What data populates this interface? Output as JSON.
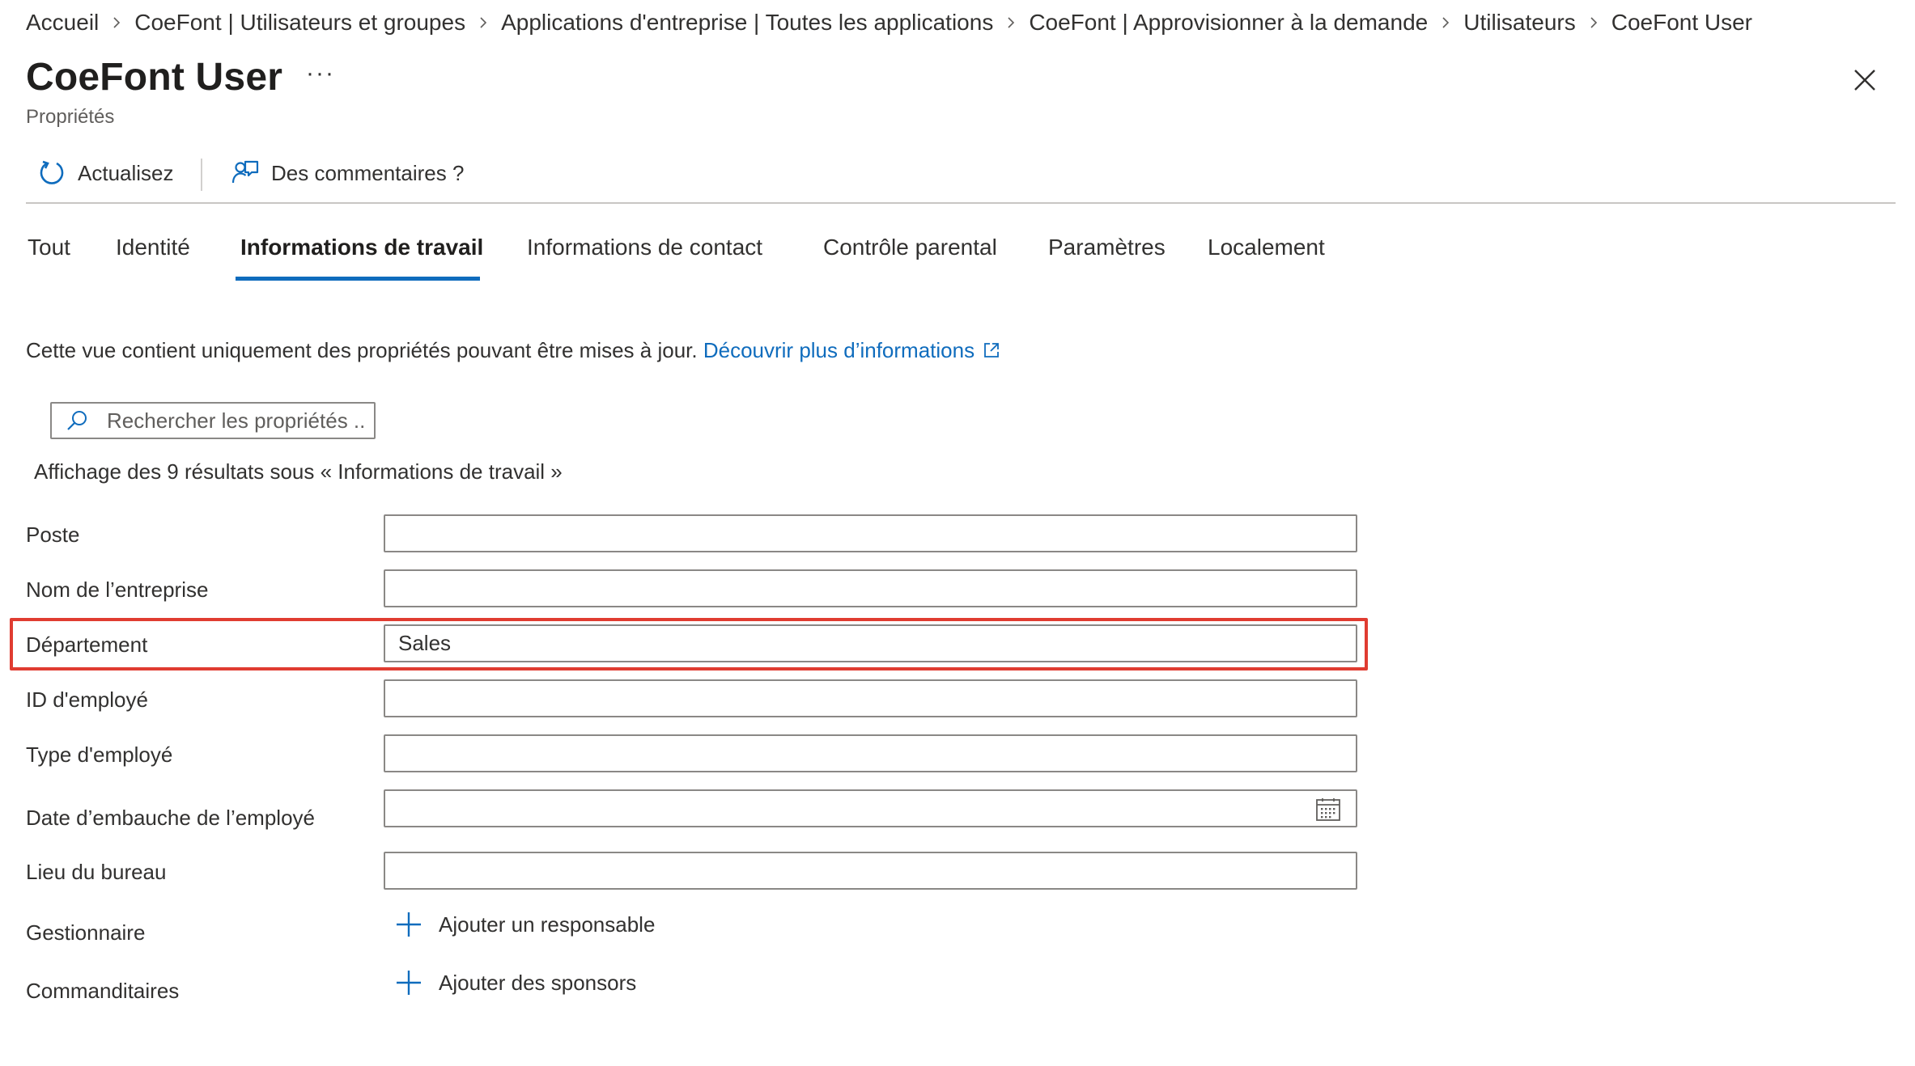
{
  "breadcrumb": [
    "Accueil",
    "CoeFont | Utilisateurs et groupes",
    "Applications d'entreprise | Toutes les applications",
    "CoeFont | Approvisionner à la demande",
    "Utilisateurs",
    "CoeFont User"
  ],
  "header": {
    "title": "CoeFont User",
    "more_label": "···",
    "subtitle": "Propriétés"
  },
  "toolbar": {
    "refresh_label": "Actualisez",
    "feedback_label": "Des commentaires ?"
  },
  "tabs": [
    "Tout",
    "Identité",
    "Informations de travail",
    "Informations de contact",
    "Contrôle parental",
    "Paramètres",
    "Localement"
  ],
  "active_tab": "Informations de travail",
  "info": {
    "text": "Cette vue contient uniquement des propriétés pouvant être mises à jour.",
    "link": "Découvrir plus d’informations"
  },
  "search": {
    "placeholder": "Rechercher les propriétés ...",
    "value": ""
  },
  "results_text": "Affichage des 9 résultats sous « Informations de travail »",
  "fields": [
    {
      "label": "Poste",
      "value": ""
    },
    {
      "label": "Nom de l’entreprise",
      "value": ""
    },
    {
      "label": "Département",
      "value": "Sales"
    },
    {
      "label": "ID d'employé",
      "value": ""
    },
    {
      "label": "Type d'employé",
      "value": ""
    },
    {
      "label": "Date d’embauche de l’employé",
      "value": ""
    },
    {
      "label": "Lieu du bureau",
      "value": ""
    }
  ],
  "manager": {
    "label": "Gestionnaire",
    "action": "Ajouter un responsable"
  },
  "sponsors": {
    "label": "Commanditaires",
    "action": "Ajouter des sponsors"
  },
  "colors": {
    "accent": "#0f6cbd",
    "highlight": "#e03c31",
    "text": "#323130",
    "border": "#8a8886"
  },
  "icons": {
    "refresh": "refresh-icon",
    "feedback": "feedback-icon",
    "search": "search-icon",
    "external": "external-link-icon",
    "calendar": "calendar-icon",
    "add": "plus-icon",
    "close": "close-icon"
  }
}
